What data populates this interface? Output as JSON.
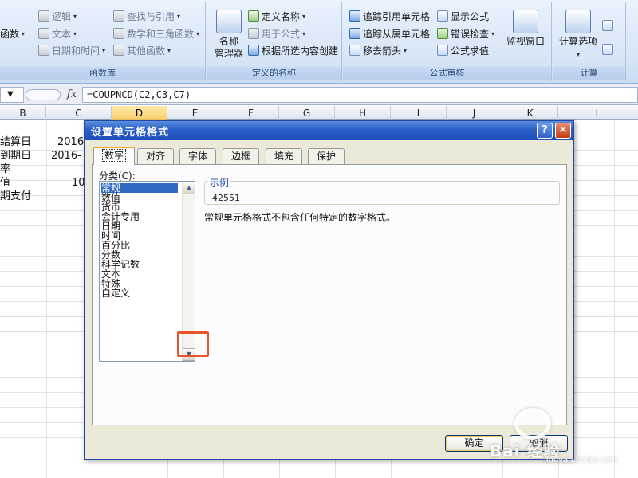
{
  "ribbon": {
    "groups": {
      "function_library": "函数库",
      "defined_names": "定义的名称",
      "formula_auditing": "公式审核",
      "calculation": "计算"
    },
    "function_library": {
      "func_partial": "函数",
      "logical": "逻辑",
      "text": "文本",
      "date_time": "日期和时间",
      "lookup_ref": "查找与引用",
      "math_trig": "数学和三角函数",
      "other_funcs": "其他函数"
    },
    "defined_names": {
      "name_manager_line1": "名称",
      "name_manager_line2": "管理器",
      "define_name": "定义名称",
      "use_in_formula": "用于公式",
      "create_from_selection": "根据所选内容创建"
    },
    "formula_auditing": {
      "trace_precedents": "追踪引用单元格",
      "trace_dependents": "追踪从属单元格",
      "remove_arrows": "移去箭头",
      "show_formulas": "显示公式",
      "error_checking": "错误检查",
      "evaluate_formula": "公式求值",
      "watch_window": "监视窗口"
    },
    "calculation": {
      "calc_options": "计算选项"
    }
  },
  "formula_bar": {
    "fx": "fx",
    "formula": "=COUPNCD(C2,C3,C7)"
  },
  "sheet": {
    "columns": [
      "B",
      "C",
      "D",
      "E",
      "F",
      "G",
      "H",
      "I",
      "J",
      "K",
      "L"
    ],
    "selected_column": "D",
    "cells": {
      "b1": "结算日",
      "b2": "到期日",
      "b3": "率",
      "b4": "值",
      "b5": "期支付",
      "c1": "2016",
      "c2": "2016-",
      "c4": "10"
    }
  },
  "dialog": {
    "title": "设置单元格格式",
    "help": "?",
    "close": "✕",
    "tabs": [
      "数字",
      "对齐",
      "字体",
      "边框",
      "填充",
      "保护"
    ],
    "active_tab": "数字",
    "category_label": "分类(C):",
    "categories": [
      "常规",
      "数值",
      "货币",
      "会计专用",
      "日期",
      "时间",
      "百分比",
      "分数",
      "科学记数",
      "文本",
      "特殊",
      "自定义"
    ],
    "selected_category": "常规",
    "highlighted_category": "日期",
    "sample_label": "示例",
    "sample_value": "42551",
    "description": "常规单元格格式不包含任何特定的数字格式。",
    "ok": "确定",
    "cancel": "取消"
  },
  "watermark": {
    "text": "Bai 经验",
    "sub": "jingyan.baidu.com"
  }
}
